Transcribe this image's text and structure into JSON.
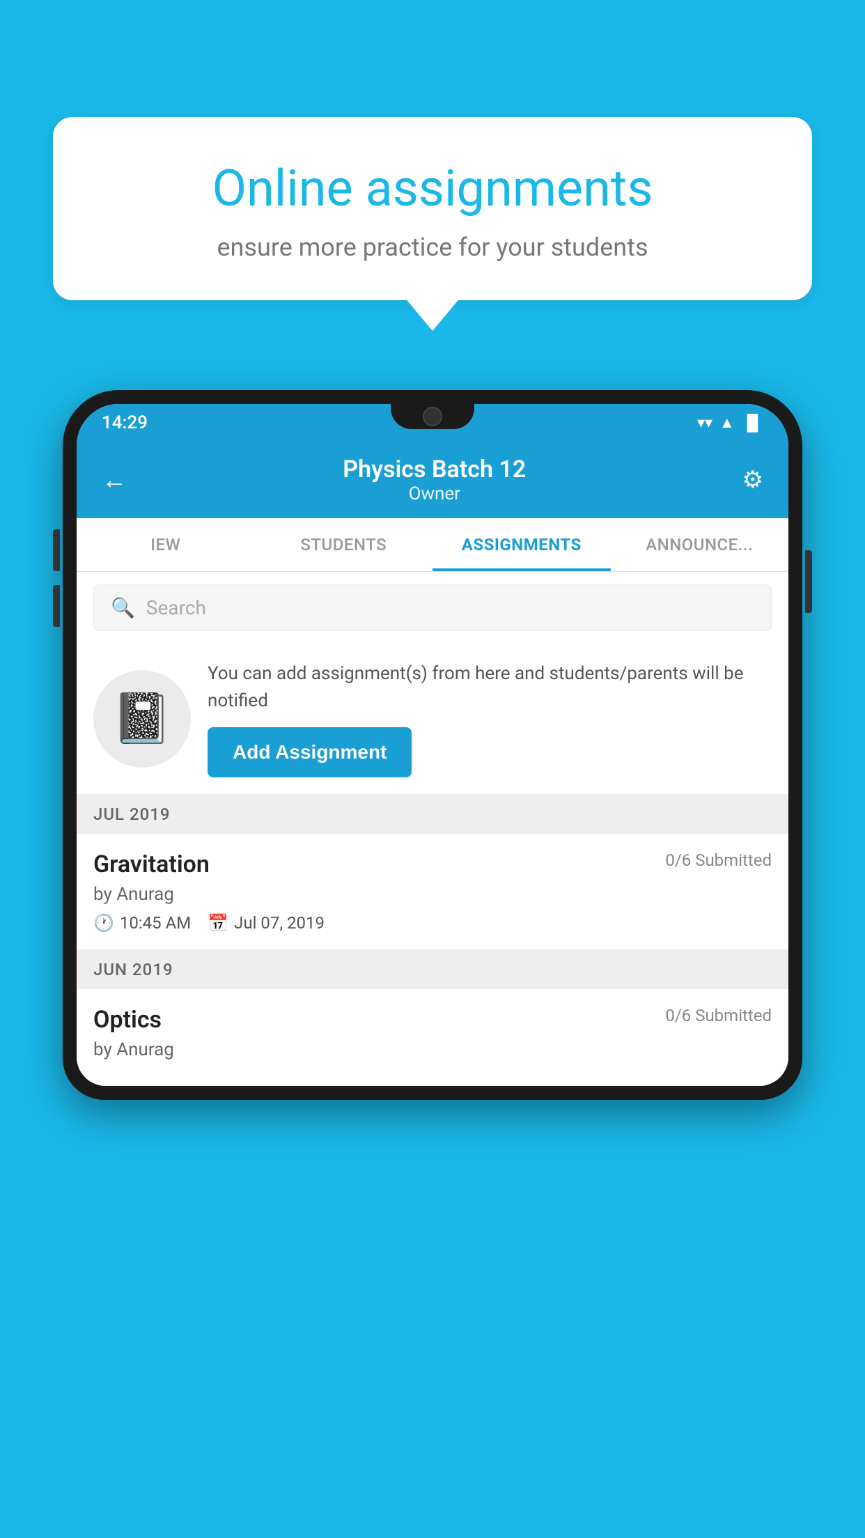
{
  "background_color": "#1ab8e8",
  "speech_bubble": {
    "title": "Online assignments",
    "subtitle": "ensure more practice for your students"
  },
  "status_bar": {
    "time": "14:29",
    "wifi": "▼",
    "signal": "▲",
    "battery": "▐"
  },
  "header": {
    "title": "Physics Batch 12",
    "subtitle": "Owner",
    "back_label": "←",
    "settings_label": "⚙"
  },
  "tabs": [
    {
      "label": "IEW",
      "active": false
    },
    {
      "label": "STUDENTS",
      "active": false
    },
    {
      "label": "ASSIGNMENTS",
      "active": true
    },
    {
      "label": "ANNOUNCEMENTS",
      "active": false
    }
  ],
  "search": {
    "placeholder": "Search"
  },
  "promo": {
    "text": "You can add assignment(s) from here and students/parents will be notified",
    "button_label": "Add Assignment"
  },
  "sections": [
    {
      "month": "JUL 2019",
      "assignments": [
        {
          "name": "Gravitation",
          "submitted": "0/6 Submitted",
          "by": "by Anurag",
          "time": "10:45 AM",
          "date": "Jul 07, 2019"
        }
      ]
    },
    {
      "month": "JUN 2019",
      "assignments": [
        {
          "name": "Optics",
          "submitted": "0/6 Submitted",
          "by": "by Anurag",
          "time": "",
          "date": ""
        }
      ]
    }
  ]
}
